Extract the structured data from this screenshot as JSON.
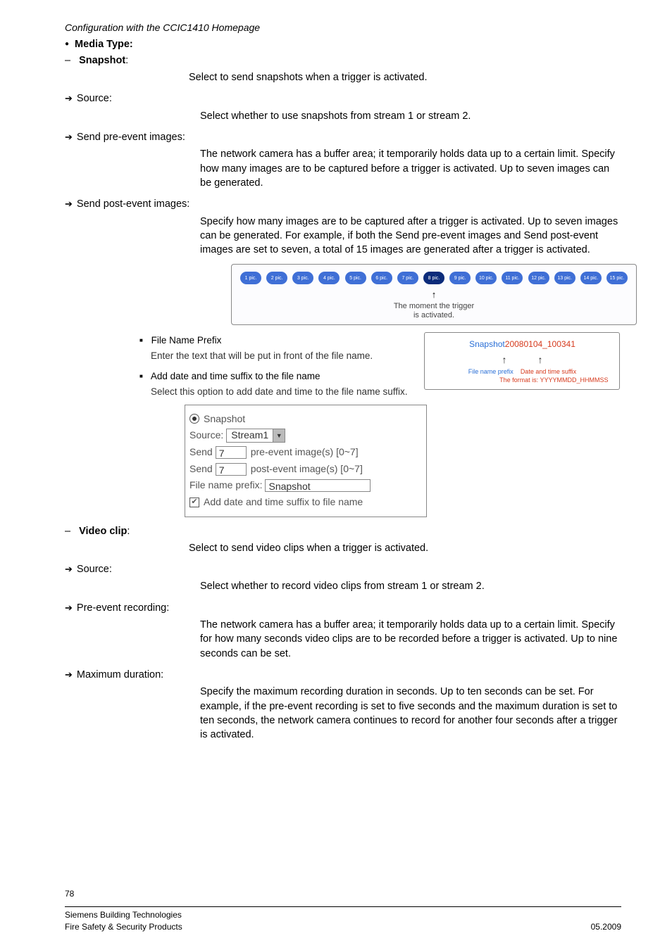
{
  "header": "Configuration with the CCIC1410 Homepage",
  "mediaTypeLabel": "Media Type:",
  "snapshot": {
    "title": "Snapshot",
    "intro": "Select to send snapshots when a trigger is activated.",
    "source": {
      "label": "Source:",
      "desc": "Select whether to use snapshots from stream 1 or stream 2."
    },
    "pre": {
      "label": "Send pre-event images:",
      "desc": "The network camera has a buffer area; it temporarily holds data up to a certain limit. Specify how many images are to be captured before a trigger is activated. Up to seven images can be generated."
    },
    "post": {
      "label": "Send post-event images:",
      "desc": "Specify how many images are to be captured after a trigger is activated. Up to seven images can be generated. For example, if both the Send pre-event images and Send post-event images are set to seven, a total of 15 images are generated after a trigger is activated."
    }
  },
  "diagram": {
    "pics": [
      "1 pic.",
      "2 pic.",
      "3 pic.",
      "4 pic.",
      "5 pic.",
      "6 pic.",
      "7 pic.",
      "8 pic.",
      "9 pic.",
      "10 pic.",
      "11 pic.",
      "12 pic.",
      "13 pic.",
      "14 pic.",
      "15 pic."
    ],
    "activeIndex": 7,
    "arrow": "↑",
    "caption1": "The moment the trigger",
    "caption2": "is activated."
  },
  "fileNamePrefix": {
    "title": "File Name Prefix",
    "desc": "Enter the text that will be put in front of the file name."
  },
  "addSuffix": {
    "title": "Add date and time suffix to the file name",
    "desc": "Select this option to add date and time to the file name suffix."
  },
  "sampleBox": {
    "prefix": "Snapshot",
    "suffix": "20080104_100341",
    "leftLabel": "File name prefix",
    "rightLabel1": "Date and time suffix",
    "rightLabel2": "The format is: YYYYMMDD_HHMMSS"
  },
  "snapshotForm": {
    "radioLabel": "Snapshot",
    "sourceLabel": "Source:",
    "sourceValue": "Stream1",
    "sendLabel": "Send",
    "preValue": "7",
    "preSuffix": "pre-event image(s) [0~7]",
    "postValue": "7",
    "postSuffix": "post-event image(s) [0~7]",
    "prefixLabel": "File name prefix:",
    "prefixValue": "Snapshot",
    "checkboxLabel": "Add date and time suffix to file name"
  },
  "videoClip": {
    "title": "Video clip",
    "intro": "Select to send video clips when a trigger is activated.",
    "source": {
      "label": "Source:",
      "desc": "Select whether to record video clips from stream 1 or stream 2."
    },
    "pre": {
      "label": "Pre-event recording:",
      "desc": "The network camera has a buffer area; it temporarily holds data up to a certain limit. Specify for how many seconds video clips are to be recorded before a trigger is activated. Up to nine seconds can be set."
    },
    "max": {
      "label": "Maximum duration:",
      "desc": "Specify the maximum recording duration in seconds. Up to ten seconds can be set. For example, if the pre-event recording is set to five seconds and the maximum duration is set to ten seconds, the network camera continues to record for another four seconds after a trigger is activated."
    }
  },
  "footer": {
    "page": "78",
    "left1": "Siemens Building Technologies",
    "left2": "Fire Safety & Security Products",
    "right": "05.2009"
  }
}
